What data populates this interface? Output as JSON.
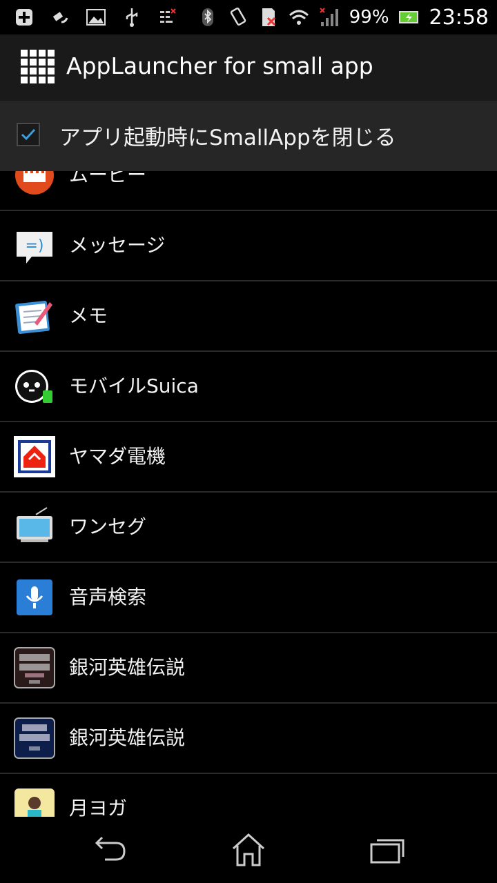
{
  "status_bar": {
    "battery_percent": "99%",
    "time": "23:58",
    "left_icons": [
      "add-notification-icon",
      "satellite-icon",
      "image-icon",
      "usb-icon",
      "sim-data-icon"
    ],
    "right_icons": [
      "bluetooth-icon",
      "rotate-icon",
      "sim-error-icon",
      "wifi-icon",
      "signal-icon",
      "battery-charging-icon"
    ]
  },
  "action_bar": {
    "title": "AppLauncher for small app",
    "icon": "grid-icon"
  },
  "option": {
    "label": "アプリ起動時にSmallAppを閉じる",
    "checked": true
  },
  "list": {
    "items": [
      {
        "label": "ムービー",
        "icon": "movie-icon"
      },
      {
        "label": "メッセージ",
        "icon": "message-icon"
      },
      {
        "label": "メモ",
        "icon": "memo-icon"
      },
      {
        "label": "モバイルSuica",
        "icon": "suica-icon"
      },
      {
        "label": "ヤマダ電機",
        "icon": "yamada-icon"
      },
      {
        "label": "ワンセグ",
        "icon": "tv-icon"
      },
      {
        "label": "音声検索",
        "icon": "voice-search-icon"
      },
      {
        "label": "銀河英雄伝説",
        "icon": "ginga-eiyuu-icon"
      },
      {
        "label": "銀河英雄伝説",
        "icon": "ginga-eiyuu-icon"
      },
      {
        "label": "月ヨガ",
        "icon": "yoga-icon"
      }
    ]
  },
  "nav_bar": {
    "buttons": [
      "back-icon",
      "home-icon",
      "recent-apps-icon"
    ]
  }
}
